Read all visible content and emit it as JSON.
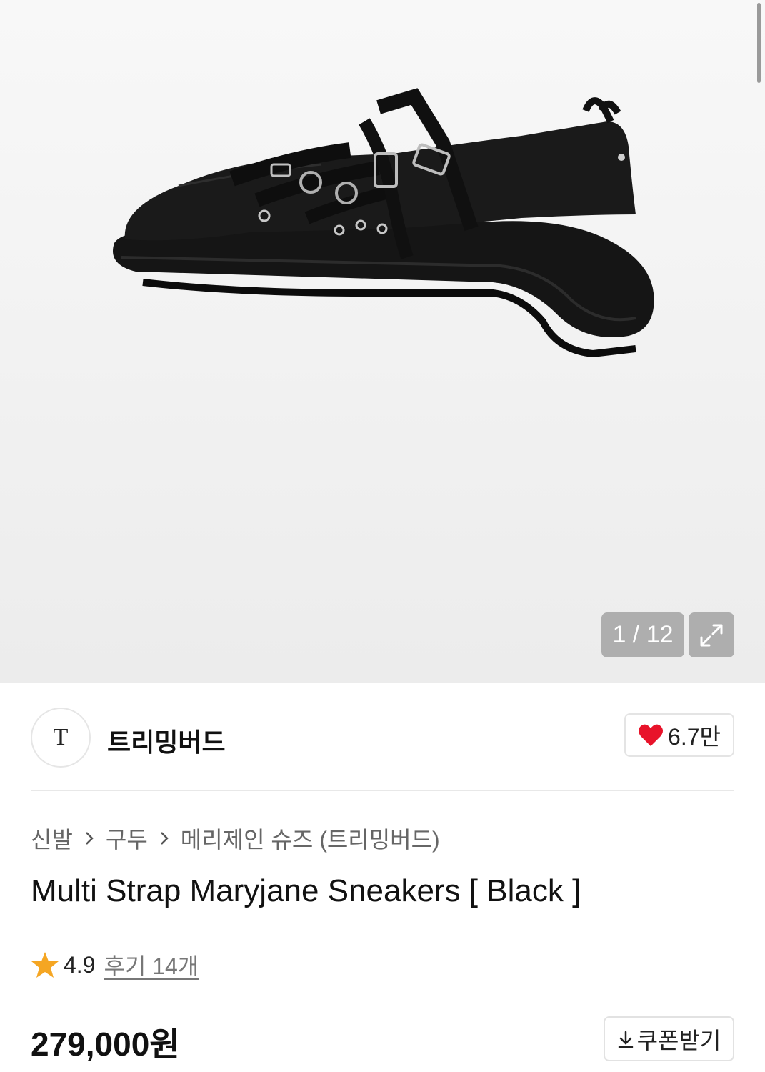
{
  "gallery": {
    "current": 1,
    "total": 12,
    "counter_text": "1 / 12"
  },
  "brand": {
    "logo_text": "T",
    "name": "트리밍버드",
    "like_count": "6.7만"
  },
  "breadcrumb": [
    "신발",
    "구두",
    "메리제인 슈즈 (트리밍버드)"
  ],
  "product": {
    "title": "Multi Strap Maryjane Sneakers [ Black ]",
    "rating": "4.9",
    "review_link": "후기 14개",
    "price": "279,000원"
  },
  "coupon": {
    "label": "쿠폰받기"
  },
  "colors": {
    "heart": "#e8132a",
    "star": "#f5a623",
    "text_primary": "#111111",
    "text_muted": "#666666"
  },
  "icons": {
    "expand": "expand-icon",
    "heart": "heart-icon",
    "star": "star-icon",
    "breadcrumb_separator": "chevron-right-icon",
    "download": "download-icon"
  }
}
